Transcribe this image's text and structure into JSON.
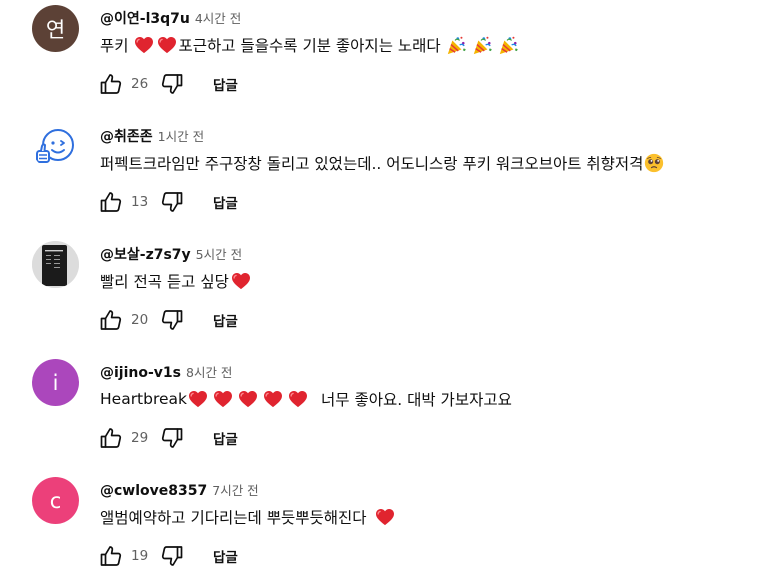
{
  "comments": [
    {
      "handle": "@이연-l3q7u",
      "time": "4시간 전",
      "text_pre": "푸키",
      "text_mid": "포근하고 들을수록 기분 좋아지는 노래다",
      "likes": "26",
      "reply_label": "답글",
      "avatar": {
        "type": "letter",
        "letter": "연",
        "color": "#5c4136"
      }
    },
    {
      "handle": "@취존존",
      "time": "1시간 전",
      "text": "퍼펙트크라임만 주구장창 돌리고 있었는데.. 어도니스랑 푸키 워크오브아트 취향저격",
      "likes": "13",
      "reply_label": "답글",
      "avatar": {
        "type": "outline",
        "color": "#2f6fde"
      }
    },
    {
      "handle": "@보살-z7s7y",
      "time": "5시간 전",
      "text": "빨리 전곡 듣고 싶당",
      "likes": "20",
      "reply_label": "답글",
      "avatar": {
        "type": "photo"
      }
    },
    {
      "handle": "@ijino-v1s",
      "time": "8시간 전",
      "text_pre": "Heartbreak",
      "text_post": "너무 좋아요. 대박 가보자고요",
      "likes": "29",
      "reply_label": "답글",
      "avatar": {
        "type": "letter",
        "letter": "i",
        "color": "#ab47bc"
      }
    },
    {
      "handle": "@cwlove8357",
      "time": "7시간 전",
      "text": "앨범예약하고 기다리는데 뿌듯뿌듯해진다",
      "likes": "19",
      "reply_label": "답글",
      "avatar": {
        "type": "letter",
        "letter": "c",
        "color": "#ec407a"
      }
    }
  ],
  "colors": {
    "heart": "#e0242f",
    "secondary_text": "#606060",
    "primary_text": "#0f0f0f"
  },
  "icons": {
    "like": "thumb-up-outline-icon",
    "dislike": "thumb-down-outline-icon",
    "heart": "red-heart-emoji",
    "party": "party-popper-emoji",
    "face": "pleading-face-emoji"
  }
}
